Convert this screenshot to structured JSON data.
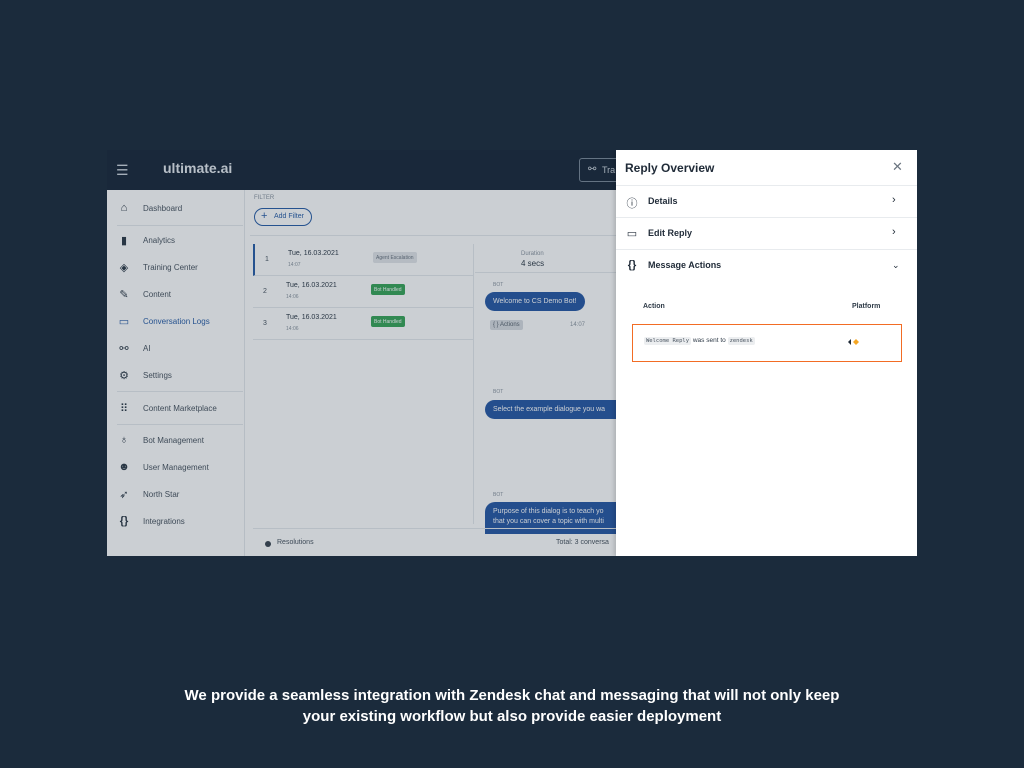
{
  "app": {
    "logo": "ultimate.ai",
    "train_label": "Tra",
    "filter_label": "FILTER",
    "add_filter": "Add Filter",
    "sidebar": [
      {
        "label": "Dashboard",
        "icon": "home-icon"
      },
      {
        "label": "Analytics",
        "icon": "bar-chart-icon"
      },
      {
        "label": "Training Center",
        "icon": "graduation-cap-icon"
      },
      {
        "label": "Content",
        "icon": "edit-icon"
      },
      {
        "label": "Conversation Logs",
        "icon": "chat-log-icon",
        "active": true
      },
      {
        "label": "AI",
        "icon": "ai-nodes-icon"
      },
      {
        "label": "Settings",
        "icon": "gear-icon"
      },
      {
        "label": "Content Marketplace",
        "icon": "grid-icon"
      },
      {
        "label": "Bot Management",
        "icon": "bot-icon"
      },
      {
        "label": "User Management",
        "icon": "users-icon"
      },
      {
        "label": "North Star",
        "icon": "rocket-icon"
      },
      {
        "label": "Integrations",
        "icon": "braces-icon"
      }
    ],
    "conversations": [
      {
        "num": "1",
        "date": "Tue, 16.03.2021",
        "time": "14:07",
        "tag": "Agent Escalation",
        "tag_color": "#e3e6ea"
      },
      {
        "num": "2",
        "date": "Tue, 16.03.2021",
        "time": "14:06",
        "tag": "Bot Handled",
        "tag_color": "#3aa65a"
      },
      {
        "num": "3",
        "date": "Tue, 16.03.2021",
        "time": "14:06",
        "tag": "Bot Handled",
        "tag_color": "#3aa65a"
      }
    ],
    "chat": {
      "duration_label": "Duration",
      "duration_value": "4 secs",
      "bot_label": "BOT",
      "messages": [
        "Welcome to CS Demo Bot!",
        "Select the example dialogue you wa",
        "Purpose of this dialog is to teach yo"
      ],
      "message_overflow": "that you can cover a topic with multi",
      "actions_chip": "{ } Actions",
      "message_time": "14:07"
    },
    "footer": {
      "resolutions": "Resolutions",
      "total": "Total: 3 conversa"
    }
  },
  "panel": {
    "title": "Reply Overview",
    "rows": [
      {
        "label": "Details",
        "icon": "info-icon"
      },
      {
        "label": "Edit Reply",
        "icon": "comment-icon"
      },
      {
        "label": "Message Actions",
        "icon": "braces-icon"
      }
    ],
    "table": {
      "col_action": "Action",
      "col_platform": "Platform",
      "reply_name": "Welcome Reply",
      "sent_text": "was sent to",
      "target": "zendesk"
    },
    "accent_color": "#f26c24"
  },
  "caption": {
    "line1": "We provide a seamless integration with Zendesk chat and messaging that will not only keep",
    "line2": "your existing workflow but also provide easier deployment"
  }
}
